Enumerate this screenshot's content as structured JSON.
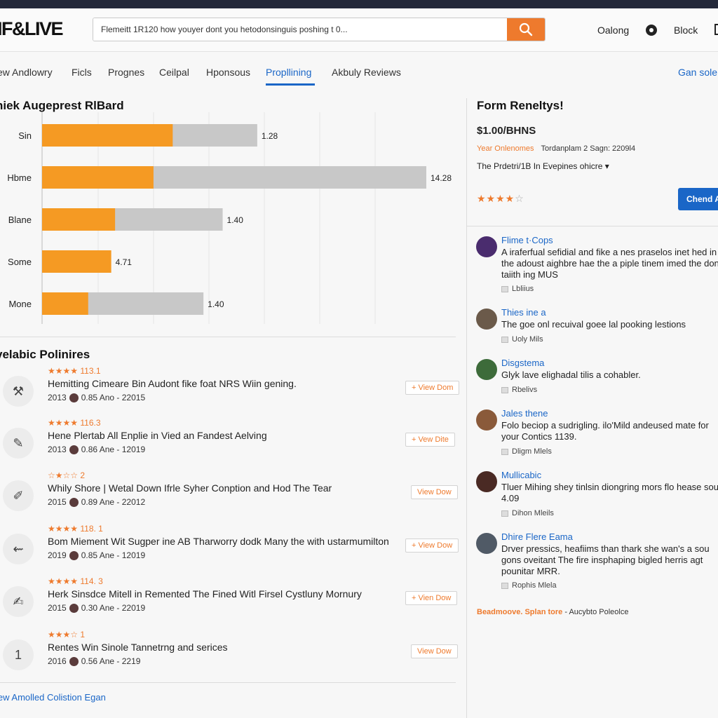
{
  "header": {
    "logo": "IF&LIVE",
    "search_placeholder": "Flemeitt 1R120 how youyer dont you hetodonsinguis poshing t 0...",
    "link1": "Oalong",
    "link2": "Block",
    "search_icon": "search-icon",
    "accent": "#ee7a2d"
  },
  "tabs": {
    "items": [
      "ew Andlowry",
      "Ficls",
      "Prognes",
      "Ceilpal",
      "Hponsous",
      "Propllining",
      "Akbuly Reviews"
    ],
    "active": "Propllining",
    "right_link": "Gan sole"
  },
  "chart_data": {
    "type": "bar",
    "title": "niek Augeprest RlBard",
    "categories": [
      "Sin",
      "Hbme",
      "Blane",
      "Some",
      "Mone"
    ],
    "series": [
      {
        "values": [
          34,
          29,
          19,
          18,
          12
        ]
      },
      {
        "values": [
          56,
          100,
          47,
          0,
          42
        ]
      }
    ],
    "data_labels": [
      "1.28",
      "14.28",
      "1.40",
      "4.71",
      "1.40"
    ],
    "colors": [
      "#f59a23",
      "#c8c8c8"
    ],
    "xlim": [
      0,
      100
    ],
    "grid": true
  },
  "policies": {
    "title": "velabic Polinires",
    "items": [
      {
        "icon": "hammer-icon",
        "glyph": "⚒",
        "stars": "★★★★",
        "rating": "113.1",
        "title": "Hemitting Cimeare Bin Audont fike foat NRS Wiin gening.",
        "year": "2013",
        "meta": "0.85 Ano - 22015",
        "button": "+ View Dom"
      },
      {
        "icon": "pen-icon",
        "glyph": "✎",
        "stars": "★★★★",
        "rating": "116.3",
        "title": "Hene Plertab All Enplie in Vied an Fandest Aelving",
        "year": "2013",
        "meta": "0.86 Ane - 12019",
        "button": "+ Vew Dite"
      },
      {
        "icon": "brush-icon",
        "glyph": "✐",
        "stars": "☆★☆☆",
        "rating": "2",
        "title": "Whily Shore | Wetal Down Ifrle Syher Conption and Hod The Tear",
        "year": "2015",
        "meta": "0.89 Ane - 22012",
        "button": "View Dow"
      },
      {
        "icon": "arrows-icon",
        "glyph": "⇜",
        "stars": "★★★★",
        "rating": "118. 1",
        "title": "Bom Miement Wit Sugper ine AB Tharworry dodk Many the with ustarmumilton",
        "year": "2019",
        "meta": "0.85 Ane - 12019",
        "button": "+ View Dow"
      },
      {
        "icon": "scribble-icon",
        "glyph": "✍",
        "stars": "★★★★",
        "rating": "114. 3",
        "title": "Herk Sinsdce Mitell in Remented The Fined Witl Firsel Cystluny Mornury",
        "year": "2015",
        "meta": "0.30 Ane - 22019",
        "button": "+ Vien Dow"
      },
      {
        "icon": "number-one-icon",
        "glyph": "1",
        "stars": "★★★☆",
        "rating": "1",
        "title": "Rentes Win Sinole Tannetrng and serices",
        "year": "2016",
        "meta": "0.56 Ane - 2219",
        "button": "View Dow"
      }
    ],
    "footer": "lew Amolled Colistion Egan"
  },
  "sidebar": {
    "title": "Form Reneltys!",
    "price": "$1.00/BHNS",
    "meta_highlight": "Year Onlenomes",
    "meta_text": "Tordanplam 2 Sagn: 2209l4",
    "dropdown": "The Prdetri/1B In Evepines ohicre ▾",
    "stars": "★★★★",
    "stars_empty": "☆",
    "cta": "Chend A",
    "reviews": [
      {
        "name": "Flime t·Cops",
        "text": "A iraferfual sefidial and fike a nes praselos inet hed in the adoust aighbre hae the a piple tinem imed the done taiith ing MUS",
        "likes": "Lbliius",
        "avatar_color": "#4a2c6e"
      },
      {
        "name": "Thies ine a",
        "text": "The goe onl recuival goee lal pooking lestions",
        "likes": "Uoly Mils",
        "avatar_color": "#6b5a4a"
      },
      {
        "name": "Disgstema",
        "text": "Glyk lave elighadal tilis a cohabler.",
        "likes": "Rbelivs",
        "avatar_color": "#3d6b3a"
      },
      {
        "name": "Jales thene",
        "text": "Folo beciop a sudrigling. ilo'Mild andeused mate for your Contics 1139.",
        "likes": "Dligm Mlels",
        "avatar_color": "#8a5a3a"
      },
      {
        "name": "Mullicabic",
        "text": "Tluer Mihing shey tinlsin diongring mors flo hease sour 4.09",
        "likes": "Dihon Mleils",
        "avatar_color": "#4a2a24"
      },
      {
        "name": "Dhire Flere Eama",
        "text": "Drver pressics, heafiims than thark she wan's a sou gons oveitant The fire insphaping bigled herris agt pounitar MRR.",
        "likes": "Rophis Mlela",
        "avatar_color": "#505a66"
      }
    ],
    "footer_a": "Beadmoove. Splan tore",
    "footer_b": "- Aucybto Poleolce"
  }
}
